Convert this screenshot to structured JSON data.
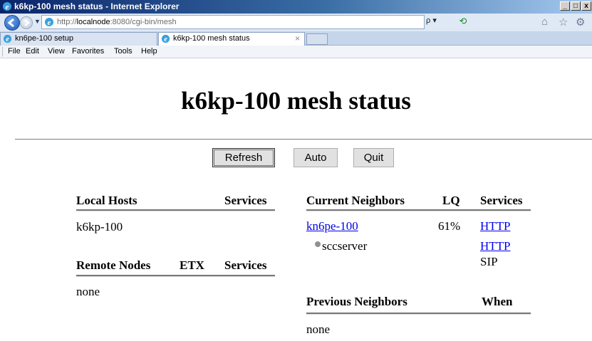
{
  "window": {
    "title": "k6kp-100 mesh status - Internet Explorer",
    "buttons": {
      "minimize": "_",
      "maximize": "□",
      "close": "x"
    }
  },
  "address": {
    "url_prefix": "http://",
    "url_host": "localnode",
    "url_rest": ":8080/cgi-bin/mesh",
    "search_label": "ρ ▾"
  },
  "tabs": [
    {
      "label": "kn6pe-100 setup",
      "active": false
    },
    {
      "label": "k6kp-100 mesh status",
      "active": true,
      "close": "×"
    }
  ],
  "menu": [
    "File",
    "Edit",
    "View",
    "Favorites",
    "Tools",
    "Help"
  ],
  "page": {
    "title": "k6kp-100 mesh status",
    "buttons": {
      "refresh": "Refresh",
      "auto": "Auto",
      "quit": "Quit"
    },
    "local_hosts": {
      "headers": {
        "name": "Local Hosts",
        "services": "Services"
      },
      "rows": [
        "k6kp-100"
      ]
    },
    "remote_nodes": {
      "headers": {
        "name": "Remote Nodes",
        "etx": "ETX",
        "services": "Services"
      },
      "empty": "none"
    },
    "current_neighbors": {
      "headers": {
        "name": "Current Neighbors",
        "lq": "LQ",
        "services": "Services"
      },
      "neighbor": {
        "name": "kn6pe-100",
        "lq": "61%",
        "service": "HTTP"
      },
      "host": {
        "name": "sccserver",
        "services": [
          "HTTP",
          "SIP"
        ]
      }
    },
    "previous_neighbors": {
      "headers": {
        "name": "Previous Neighbors",
        "when": "When"
      },
      "empty": "none"
    }
  },
  "colors": {
    "link": "#0000ee",
    "titlebar": "#0a246a"
  },
  "icons": [
    "ie-logo-icon",
    "back-icon",
    "forward-icon",
    "refresh-icon",
    "home-icon",
    "favorites-star-icon",
    "tools-gear-icon"
  ]
}
